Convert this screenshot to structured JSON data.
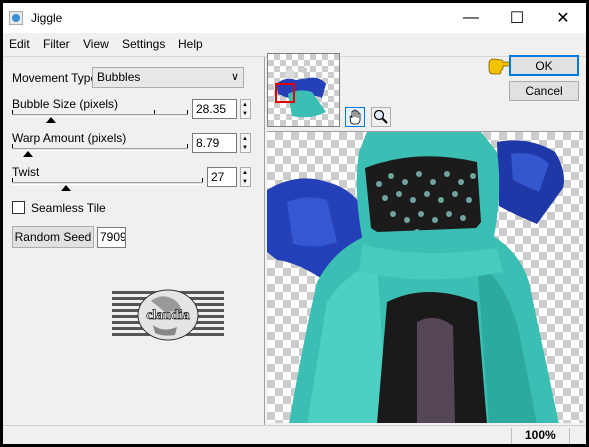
{
  "window": {
    "title": "Jiggle",
    "minimize": "—",
    "maximize": "☐",
    "close": "✕"
  },
  "menu": [
    "Edit",
    "Filter",
    "View",
    "Settings",
    "Help"
  ],
  "controls": {
    "movement_type_label": "Movement Type:",
    "movement_type_value": "Bubbles",
    "bubble_size_label": "Bubble Size (pixels)",
    "bubble_size_value": "28.35",
    "warp_amount_label": "Warp Amount (pixels)",
    "warp_amount_value": "8.79",
    "twist_label": "Twist",
    "twist_value": "27",
    "seamless_tile_label": "Seamless Tile",
    "seamless_tile_checked": false,
    "random_seed_label": "Random Seed",
    "random_seed_value": "7909"
  },
  "buttons": {
    "ok": "OK",
    "cancel": "Cancel"
  },
  "logo": {
    "text": "claudia"
  },
  "status": {
    "zoom": "100%"
  },
  "colors": {
    "accent": "#0078d7",
    "dress_teal": "#3bbfb4",
    "dress_blue": "#2340b8",
    "pointer_yellow": "#f2c200"
  }
}
